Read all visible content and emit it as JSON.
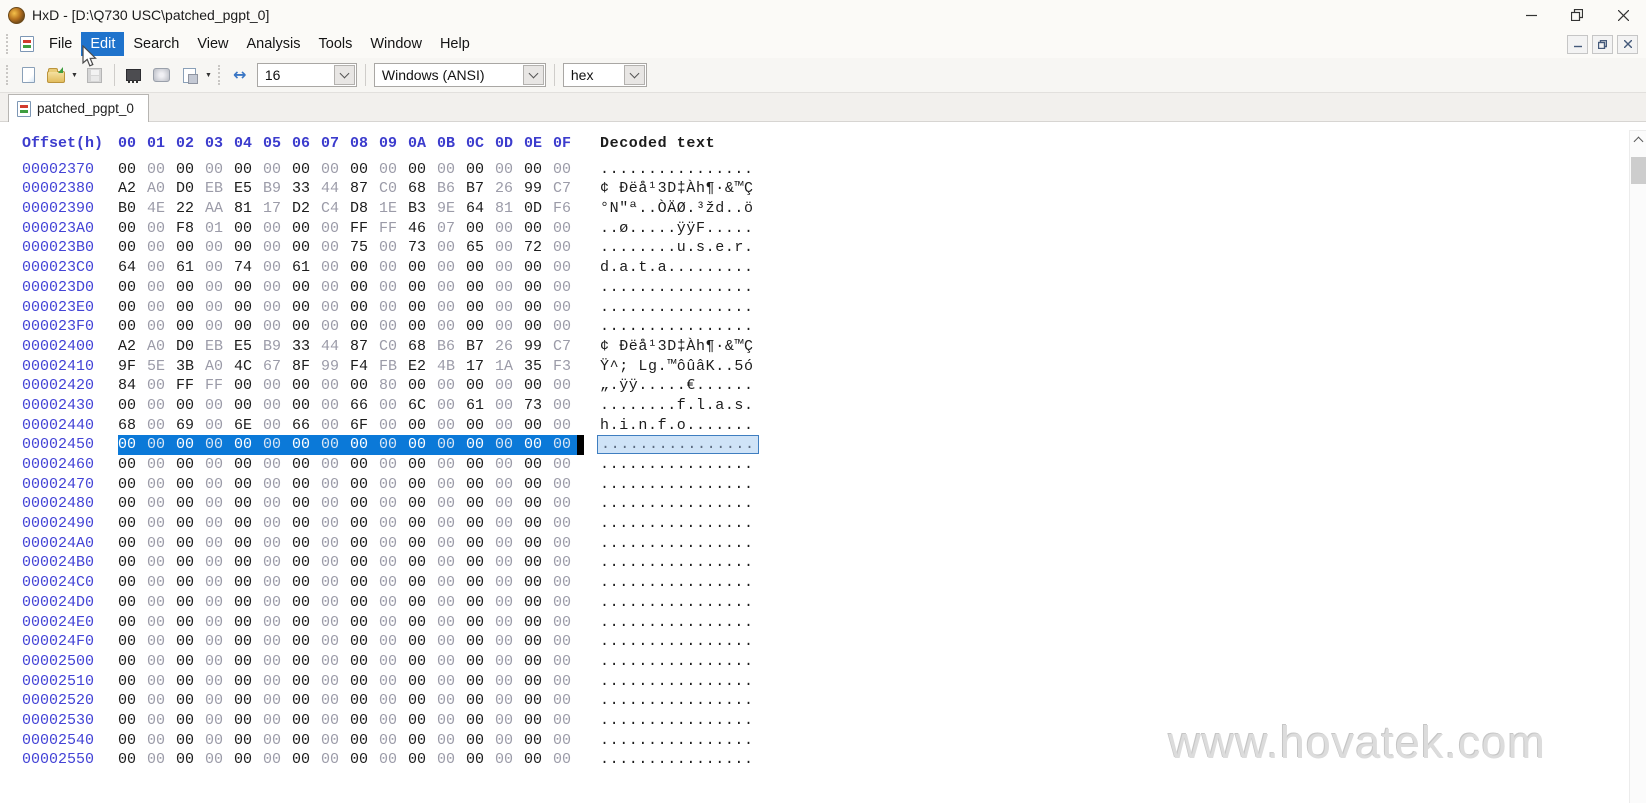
{
  "window": {
    "title": "HxD - [D:\\Q730 USC\\patched_pgpt_0]",
    "controls": [
      "minimize",
      "restore",
      "close"
    ]
  },
  "menubar": {
    "items": [
      {
        "label": "File",
        "active": false
      },
      {
        "label": "Edit",
        "active": true
      },
      {
        "label": "Search",
        "active": false
      },
      {
        "label": "View",
        "active": false
      },
      {
        "label": "Analysis",
        "active": false
      },
      {
        "label": "Tools",
        "active": false
      },
      {
        "label": "Window",
        "active": false
      },
      {
        "label": "Help",
        "active": false
      }
    ],
    "mdi_controls": [
      "minimize",
      "restore",
      "close"
    ]
  },
  "toolbar": {
    "icons": [
      "new-file",
      "open-file",
      "save",
      "open-ram",
      "open-disk",
      "open-disk-image",
      "bytes-per-row"
    ],
    "bytes_per_row": "16",
    "encoding": "Windows (ANSI)",
    "offset_base": "hex"
  },
  "tab": {
    "label": "patched_pgpt_0"
  },
  "hex_editor": {
    "header": {
      "offset_label": "Offset(h)",
      "byte_labels": [
        "00",
        "01",
        "02",
        "03",
        "04",
        "05",
        "06",
        "07",
        "08",
        "09",
        "0A",
        "0B",
        "0C",
        "0D",
        "0E",
        "0F"
      ],
      "decoded_label": "Decoded text"
    },
    "rows": [
      {
        "offset": "00002370",
        "bytes": "00 00 00 00 00 00 00 00 00 00 00 00 00 00 00 00",
        "decoded": "................",
        "selected": false
      },
      {
        "offset": "00002380",
        "bytes": "A2 A0 D0 EB E5 B9 33 44 87 C0 68 B6 B7 26 99 C7",
        "decoded": "¢ Ðëå¹3D‡Àh¶·&™Ç",
        "selected": false
      },
      {
        "offset": "00002390",
        "bytes": "B0 4E 22 AA 81 17 D2 C4 D8 1E B3 9E 64 81 0D F6",
        "decoded": "°N\"ª..ÒÄØ.³žd..ö",
        "selected": false
      },
      {
        "offset": "000023A0",
        "bytes": "00 00 F8 01 00 00 00 00 FF FF 46 07 00 00 00 00",
        "decoded": "..ø.....ÿÿF.....",
        "selected": false
      },
      {
        "offset": "000023B0",
        "bytes": "00 00 00 00 00 00 00 00 75 00 73 00 65 00 72 00",
        "decoded": "........u.s.e.r.",
        "selected": false
      },
      {
        "offset": "000023C0",
        "bytes": "64 00 61 00 74 00 61 00 00 00 00 00 00 00 00 00",
        "decoded": "d.a.t.a.........",
        "selected": false
      },
      {
        "offset": "000023D0",
        "bytes": "00 00 00 00 00 00 00 00 00 00 00 00 00 00 00 00",
        "decoded": "................",
        "selected": false
      },
      {
        "offset": "000023E0",
        "bytes": "00 00 00 00 00 00 00 00 00 00 00 00 00 00 00 00",
        "decoded": "................",
        "selected": false
      },
      {
        "offset": "000023F0",
        "bytes": "00 00 00 00 00 00 00 00 00 00 00 00 00 00 00 00",
        "decoded": "................",
        "selected": false
      },
      {
        "offset": "00002400",
        "bytes": "A2 A0 D0 EB E5 B9 33 44 87 C0 68 B6 B7 26 99 C7",
        "decoded": "¢ Ðëå¹3D‡Àh¶·&™Ç",
        "selected": false
      },
      {
        "offset": "00002410",
        "bytes": "9F 5E 3B A0 4C 67 8F 99 F4 FB E2 4B 17 1A 35 F3",
        "decoded": "Ÿ^; Lg.™ôûâK..5ó",
        "selected": false
      },
      {
        "offset": "00002420",
        "bytes": "84 00 FF FF 00 00 00 00 00 80 00 00 00 00 00 00",
        "decoded": "„.ÿÿ.....€......",
        "selected": false
      },
      {
        "offset": "00002430",
        "bytes": "00 00 00 00 00 00 00 00 66 00 6C 00 61 00 73 00",
        "decoded": "........f.l.a.s.",
        "selected": false
      },
      {
        "offset": "00002440",
        "bytes": "68 00 69 00 6E 00 66 00 6F 00 00 00 00 00 00 00",
        "decoded": "h.i.n.f.o.......",
        "selected": false
      },
      {
        "offset": "00002450",
        "bytes": "00 00 00 00 00 00 00 00 00 00 00 00 00 00 00 00",
        "decoded": "................",
        "selected": true
      },
      {
        "offset": "00002460",
        "bytes": "00 00 00 00 00 00 00 00 00 00 00 00 00 00 00 00",
        "decoded": "................",
        "selected": false
      },
      {
        "offset": "00002470",
        "bytes": "00 00 00 00 00 00 00 00 00 00 00 00 00 00 00 00",
        "decoded": "................",
        "selected": false
      },
      {
        "offset": "00002480",
        "bytes": "00 00 00 00 00 00 00 00 00 00 00 00 00 00 00 00",
        "decoded": "................",
        "selected": false
      },
      {
        "offset": "00002490",
        "bytes": "00 00 00 00 00 00 00 00 00 00 00 00 00 00 00 00",
        "decoded": "................",
        "selected": false
      },
      {
        "offset": "000024A0",
        "bytes": "00 00 00 00 00 00 00 00 00 00 00 00 00 00 00 00",
        "decoded": "................",
        "selected": false
      },
      {
        "offset": "000024B0",
        "bytes": "00 00 00 00 00 00 00 00 00 00 00 00 00 00 00 00",
        "decoded": "................",
        "selected": false
      },
      {
        "offset": "000024C0",
        "bytes": "00 00 00 00 00 00 00 00 00 00 00 00 00 00 00 00",
        "decoded": "................",
        "selected": false
      },
      {
        "offset": "000024D0",
        "bytes": "00 00 00 00 00 00 00 00 00 00 00 00 00 00 00 00",
        "decoded": "................",
        "selected": false
      },
      {
        "offset": "000024E0",
        "bytes": "00 00 00 00 00 00 00 00 00 00 00 00 00 00 00 00",
        "decoded": "................",
        "selected": false
      },
      {
        "offset": "000024F0",
        "bytes": "00 00 00 00 00 00 00 00 00 00 00 00 00 00 00 00",
        "decoded": "................",
        "selected": false
      },
      {
        "offset": "00002500",
        "bytes": "00 00 00 00 00 00 00 00 00 00 00 00 00 00 00 00",
        "decoded": "................",
        "selected": false
      },
      {
        "offset": "00002510",
        "bytes": "00 00 00 00 00 00 00 00 00 00 00 00 00 00 00 00",
        "decoded": "................",
        "selected": false
      },
      {
        "offset": "00002520",
        "bytes": "00 00 00 00 00 00 00 00 00 00 00 00 00 00 00 00",
        "decoded": "................",
        "selected": false
      },
      {
        "offset": "00002530",
        "bytes": "00 00 00 00 00 00 00 00 00 00 00 00 00 00 00 00",
        "decoded": "................",
        "selected": false
      },
      {
        "offset": "00002540",
        "bytes": "00 00 00 00 00 00 00 00 00 00 00 00 00 00 00 00",
        "decoded": "................",
        "selected": false
      },
      {
        "offset": "00002550",
        "bytes": "00 00 00 00 00 00 00 00 00 00 00 00 00 00 00 00",
        "decoded": "................",
        "selected": false
      }
    ]
  },
  "watermark": "www.hovatek.com",
  "colors": {
    "selection_hex_bg": "#0b79d8",
    "selection_decoded_bg": "#cfe3f7",
    "selection_decoded_border": "#3f7ec0",
    "offset_text": "#4343d6",
    "header_text": "#3c3ccd",
    "menu_highlight": "#1f73cc"
  }
}
